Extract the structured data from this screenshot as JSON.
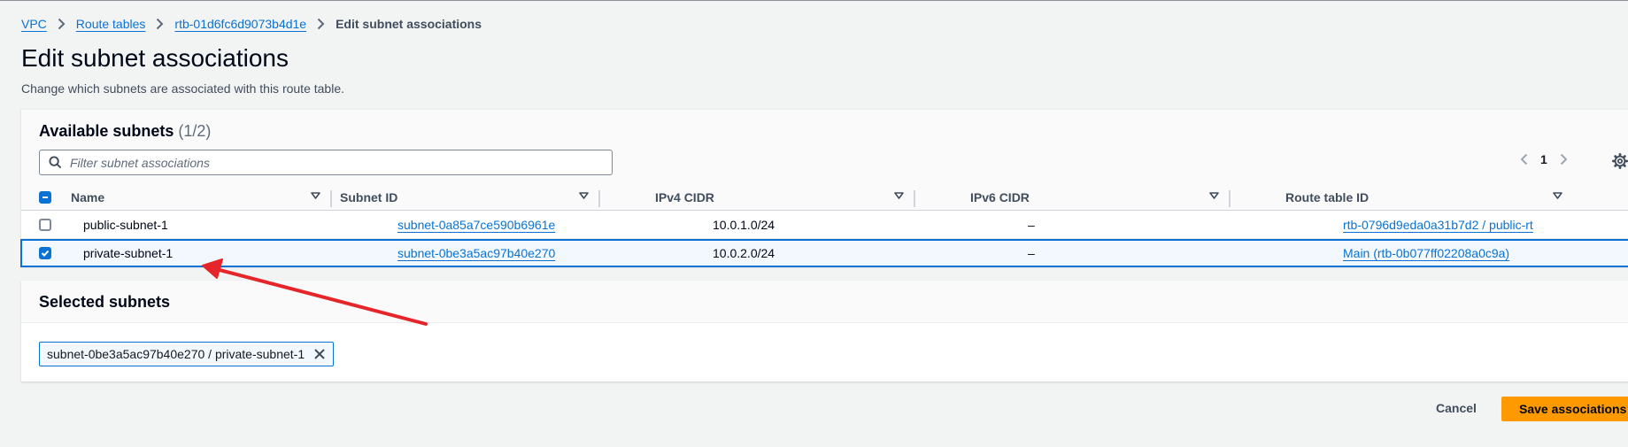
{
  "breadcrumb": {
    "items": [
      "VPC",
      "Route tables",
      "rtb-01d6fc6d9073b4d1e"
    ],
    "current": "Edit subnet associations"
  },
  "header": {
    "title": "Edit subnet associations",
    "description": "Change which subnets are associated with this route table."
  },
  "available": {
    "title": "Available subnets",
    "count": "(1/2)",
    "filter_placeholder": "Filter subnet associations",
    "page": "1",
    "columns": [
      "Name",
      "Subnet ID",
      "IPv4 CIDR",
      "IPv6 CIDR",
      "Route table ID"
    ],
    "rows": [
      {
        "selected": false,
        "name": "public-subnet-1",
        "subnet_id": "subnet-0a85a7ce590b6961e",
        "ipv4": "10.0.1.0/24",
        "ipv6": "–",
        "route_table": "rtb-0796d9eda0a31b7d2 / public-rt"
      },
      {
        "selected": true,
        "name": "private-subnet-1",
        "subnet_id": "subnet-0be3a5ac97b40e270",
        "ipv4": "10.0.2.0/24",
        "ipv6": "–",
        "route_table": "Main (rtb-0b077ff02208a0c9a)"
      }
    ]
  },
  "selected_panel": {
    "title": "Selected subnets",
    "token": "subnet-0be3a5ac97b40e270 / private-subnet-1"
  },
  "actions": {
    "cancel": "Cancel",
    "save": "Save associations"
  },
  "colors": {
    "link": "#0972d3",
    "primary_button": "#ff9900",
    "annotation_arrow": "#e5252a"
  },
  "icons": [
    "chevron-right-icon",
    "search-icon",
    "sort-caret-icon",
    "chevron-left-icon",
    "settings-gear-icon",
    "close-icon",
    "checkbox-indeterminate-icon",
    "checkmark-icon"
  ]
}
